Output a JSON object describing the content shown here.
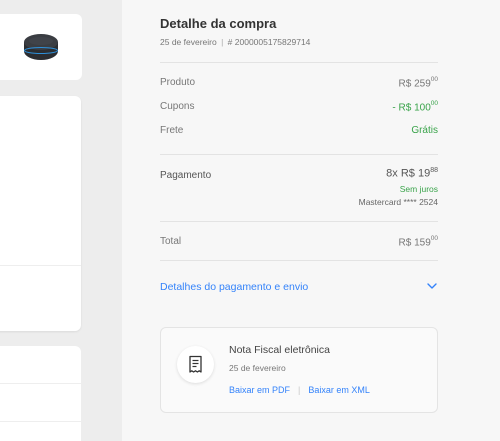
{
  "colors": {
    "accent_blue": "#3483fa",
    "green": "#39a34a",
    "panel_bg": "#f7f7f7",
    "page_bg": "#ededed"
  },
  "product": {
    "icon": "echo-dot-speaker-icon"
  },
  "purchase": {
    "title": "Detalhe da compra",
    "date": "25 de fevereiro",
    "separator": "|",
    "order_number": "# 2000005175829714"
  },
  "summary": {
    "product_label": "Produto",
    "product_value_int": "R$ 259",
    "product_value_cents": "00",
    "coupons_label": "Cupons",
    "coupons_value_int": "- R$ 100",
    "coupons_value_cents": "00",
    "shipping_label": "Frete",
    "shipping_value": "Grátis"
  },
  "payment": {
    "label": "Pagamento",
    "installments_int": "8x R$ 19",
    "installments_cents": "88",
    "interest": "Sem juros",
    "card": "Mastercard **** 2524"
  },
  "total": {
    "label": "Total",
    "value_int": "R$ 159",
    "value_cents": "00"
  },
  "details_link": {
    "label": "Detalhes do pagamento e envio",
    "icon": "chevron-down-icon"
  },
  "invoice": {
    "icon": "receipt-icon",
    "title": "Nota Fiscal eletrônica",
    "date": "25 de fevereiro",
    "download_pdf": "Baixar em PDF",
    "separator": "|",
    "download_xml": "Baixar em XML"
  }
}
